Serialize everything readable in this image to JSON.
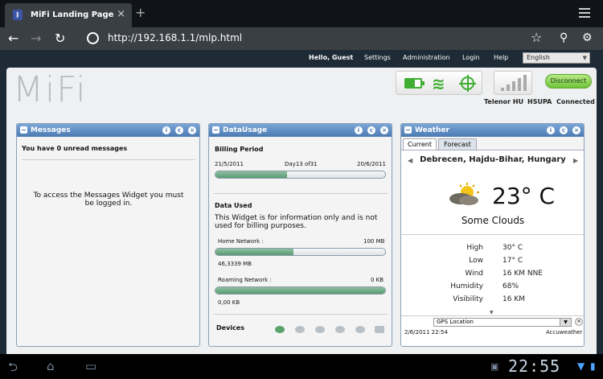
{
  "browser": {
    "tab_title": "MiFi Landing Page",
    "tab_close": "×",
    "new_tab": "+",
    "url": "http://192.168.1.1/mlp.html",
    "back": "←",
    "forward": "→",
    "reload": "↻",
    "bookmark": "☆",
    "search": "⚲",
    "settings": "⚙"
  },
  "topnav": {
    "greeting": "Hello, Guest",
    "items": [
      "Settings",
      "Administration",
      "Login",
      "Help"
    ],
    "language": "English"
  },
  "header": {
    "logo": "MiFi",
    "disconnect": "Disconnect",
    "carrier": "Telenor HU",
    "network_type": "HSUPA",
    "connection_status": "Connected",
    "colors": {
      "accent_green": "#3fae33",
      "widget_header": "#4b7ab3"
    }
  },
  "messages": {
    "title": "Messages",
    "unread": "You have 0 unread messages",
    "notice": "To access the Messages Widget you must be logged in."
  },
  "datausage": {
    "title": "DataUsage",
    "billing_label": "Billing Period",
    "start": "21/5/2011",
    "day": "Day13 of31",
    "end": "20/6/2011",
    "billing_progress": 0.42,
    "data_used_label": "Data Used",
    "disclaimer": "This Widget is for information only and is not used for billing purposes.",
    "home_label": "Home Network :",
    "home_limit": "100 MB",
    "home_value": "46,3339 MB",
    "home_progress": 0.46,
    "roaming_label": "Roaming Network :",
    "roaming_limit": "0 KB",
    "roaming_value": "0,00 KB",
    "roaming_progress": 1.0,
    "devices_label": "Devices"
  },
  "weather": {
    "title": "Weather",
    "tab_current": "Current",
    "tab_forecast": "Forecast",
    "location": "Debrecen, Hajdu-Bihar, Hungary",
    "temperature": "23° C",
    "condition": "Some Clouds",
    "details": [
      {
        "label": "High",
        "value": "30° C"
      },
      {
        "label": "Low",
        "value": "17° C"
      },
      {
        "label": "Wind",
        "value": "16 KM NNE"
      },
      {
        "label": "Humidity",
        "value": "68%"
      },
      {
        "label": "Visibility",
        "value": "16 KM"
      }
    ],
    "gps": "GPS Location",
    "date": "2/6/2011 22:54",
    "provider": "Accuweather"
  },
  "system": {
    "clock": "22:55"
  }
}
